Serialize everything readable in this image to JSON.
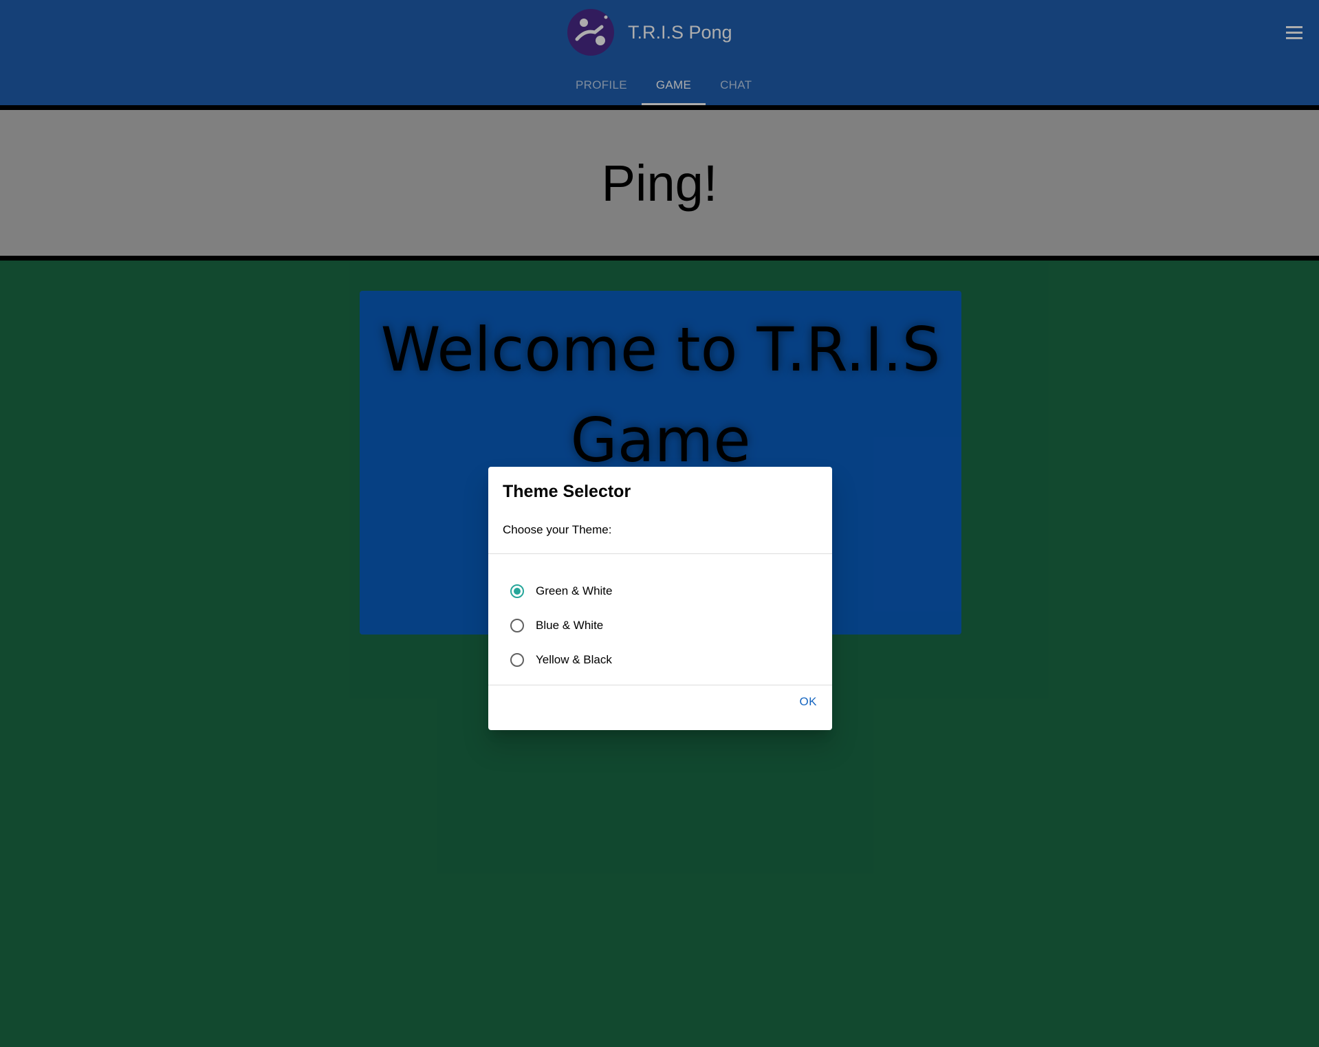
{
  "header": {
    "app_title": "T.R.I.S Pong",
    "logo_icon": "ping-pong-logo-icon",
    "menu_icon": "hamburger-menu-icon",
    "tabs": [
      {
        "label": "PROFILE",
        "active": false
      },
      {
        "label": "GAME",
        "active": true
      },
      {
        "label": "CHAT",
        "active": false
      }
    ]
  },
  "banner": {
    "text": "Ping!"
  },
  "game": {
    "welcome_line1": "Welcome to T.R.I.S",
    "welcome_line2": "Game"
  },
  "dialog": {
    "title": "Theme Selector",
    "subtitle": "Choose your Theme:",
    "options": [
      {
        "label": "Green & White",
        "selected": true
      },
      {
        "label": "Blue & White",
        "selected": false
      },
      {
        "label": "Yellow & Black",
        "selected": false
      }
    ],
    "ok_label": "OK"
  },
  "colors": {
    "header_bg": "#1f5fb0",
    "page_bg": "#1a6b46",
    "banner_bg": "#bdbdbd",
    "game_panel_bg": "#0a5fc2",
    "radio_accent": "#26a69a",
    "ok_text": "#1565c0"
  }
}
